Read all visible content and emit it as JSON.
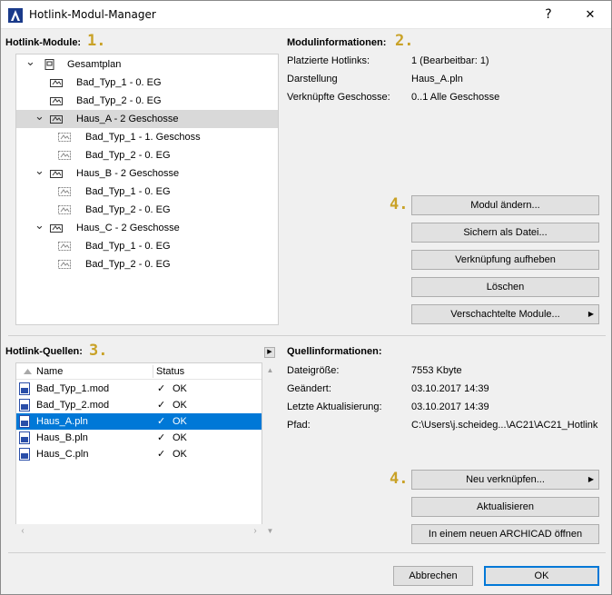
{
  "window": {
    "title": "Hotlink-Modul-Manager",
    "help_label": "?",
    "close_label": "✕"
  },
  "steps": {
    "one": "1.",
    "two": "2.",
    "three": "3.",
    "four_a": "4.",
    "four_b": "4."
  },
  "modules": {
    "label": "Hotlink-Module:",
    "tree": [
      {
        "label": "Gesamtplan",
        "level": 0,
        "expanded": true,
        "icon": "layout-sheet-icon"
      },
      {
        "label": "Bad_Typ_1 - 0. EG",
        "level": 1,
        "icon": "module-icon"
      },
      {
        "label": "Bad_Typ_2 - 0. EG",
        "level": 1,
        "icon": "module-icon"
      },
      {
        "label": "Haus_A - 2 Geschosse",
        "level": 1,
        "expanded": true,
        "selected": true,
        "icon": "module-icon"
      },
      {
        "label": "Bad_Typ_1 - 1. Geschoss",
        "level": 2,
        "icon": "nested-module-icon"
      },
      {
        "label": "Bad_Typ_2 - 0. EG",
        "level": 2,
        "icon": "nested-module-icon"
      },
      {
        "label": "Haus_B - 2 Geschosse",
        "level": 1,
        "expanded": true,
        "icon": "module-icon"
      },
      {
        "label": "Bad_Typ_1 - 0. EG",
        "level": 2,
        "icon": "nested-module-icon"
      },
      {
        "label": "Bad_Typ_2 - 0. EG",
        "level": 2,
        "icon": "nested-module-icon"
      },
      {
        "label": "Haus_C - 2 Geschosse",
        "level": 1,
        "expanded": true,
        "icon": "module-icon"
      },
      {
        "label": "Bad_Typ_1 - 0. EG",
        "level": 2,
        "icon": "nested-module-icon"
      },
      {
        "label": "Bad_Typ_2 - 0. EG",
        "level": 2,
        "icon": "nested-module-icon"
      }
    ]
  },
  "module_info": {
    "label": "Modulinformationen:",
    "rows": [
      {
        "key": "Platzierte Hotlinks:",
        "value": "1 (Bearbeitbar: 1)"
      },
      {
        "key": "Darstellung",
        "value": "Haus_A.pln"
      },
      {
        "key": "Verknüpfte Geschosse:",
        "value": "0..1 Alle Geschosse"
      }
    ],
    "buttons": {
      "change": "Modul ändern...",
      "save_as_file": "Sichern als Datei...",
      "break_link": "Verknüpfung aufheben",
      "delete": "Löschen",
      "nested": "Verschachtelte Module..."
    }
  },
  "sources": {
    "label": "Hotlink-Quellen:",
    "col_name": "Name",
    "col_status": "Status",
    "rows": [
      {
        "name": "Bad_Typ_1.mod",
        "status": "OK",
        "check": "✓"
      },
      {
        "name": "Bad_Typ_2.mod",
        "status": "OK",
        "check": "✓"
      },
      {
        "name": "Haus_A.pln",
        "status": "OK",
        "check": "✓",
        "selected": true
      },
      {
        "name": "Haus_B.pln",
        "status": "OK",
        "check": "✓"
      },
      {
        "name": "Haus_C.pln",
        "status": "OK",
        "check": "✓"
      }
    ]
  },
  "source_info": {
    "label": "Quellinformationen:",
    "rows": [
      {
        "key": "Dateigröße:",
        "value": "7553 Kbyte"
      },
      {
        "key": "Geändert:",
        "value": "03.10.2017 14:39"
      },
      {
        "key": "Letzte Aktualisierung:",
        "value": "03.10.2017 14:39"
      },
      {
        "key": "Pfad:",
        "value": "C:\\Users\\j.scheideg...\\AC21\\AC21_Hotlink"
      }
    ],
    "buttons": {
      "relink": "Neu verknüpfen...",
      "update": "Aktualisieren",
      "open_new": "In einem neuen ARCHICAD öffnen"
    }
  },
  "footer": {
    "cancel": "Abbrechen",
    "ok": "OK"
  },
  "colors": {
    "accent": "#0078d7",
    "step_number": "#c9a227",
    "selection_gray": "#d9d9d9"
  }
}
